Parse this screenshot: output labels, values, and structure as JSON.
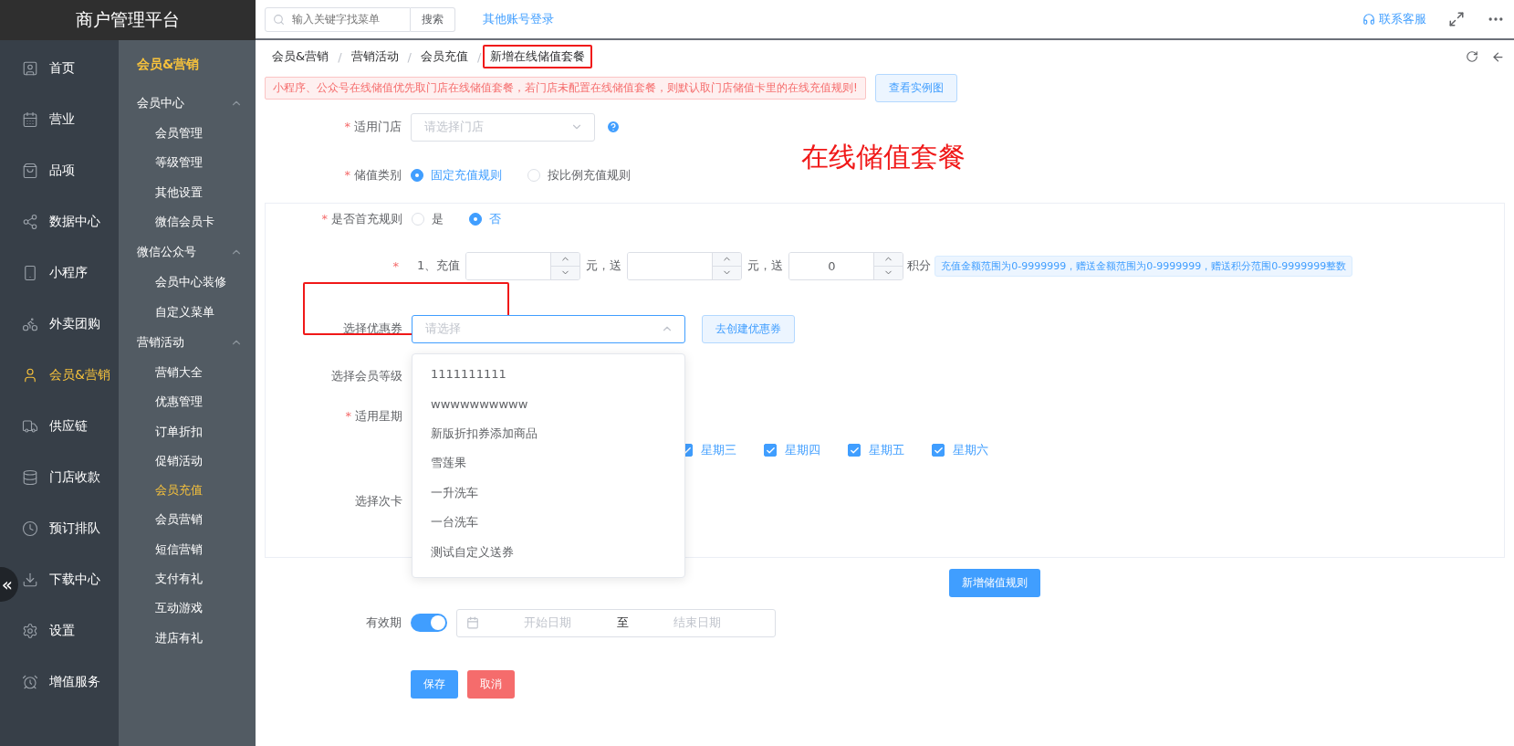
{
  "header": {
    "title": "商户管理平台",
    "search": {
      "placeholder": "输入关键字找菜单"
    },
    "search_button": "搜索",
    "other_login": "其他账号登录",
    "service": "联系客服"
  },
  "nav": [
    {
      "label": "首页",
      "selected": false
    },
    {
      "label": "营业",
      "selected": false
    },
    {
      "label": "品项",
      "selected": false
    },
    {
      "label": "数据中心",
      "selected": false
    },
    {
      "label": "小程序",
      "selected": false
    },
    {
      "label": "外卖团购",
      "selected": false
    },
    {
      "label": "会员&营销",
      "selected": true
    },
    {
      "label": "供应链",
      "selected": false
    },
    {
      "label": "门店收款",
      "selected": false
    },
    {
      "label": "预订排队",
      "selected": false
    },
    {
      "label": "下载中心",
      "selected": false
    },
    {
      "label": "设置",
      "selected": false
    },
    {
      "label": "增值服务",
      "selected": false
    }
  ],
  "collapse": "«",
  "subnav": {
    "title": "会员&营销",
    "groups": [
      {
        "label": "会员中心",
        "expanded": true,
        "children": [
          {
            "label": "会员管理",
            "selected": false
          },
          {
            "label": "等级管理",
            "selected": false
          },
          {
            "label": "其他设置",
            "selected": false
          },
          {
            "label": "微信会员卡",
            "selected": false
          }
        ]
      },
      {
        "label": "微信公众号",
        "expanded": true,
        "children": [
          {
            "label": "会员中心装修",
            "selected": false
          },
          {
            "label": "自定义菜单",
            "selected": false
          }
        ]
      },
      {
        "label": "营销活动",
        "expanded": true,
        "children": [
          {
            "label": "营销大全",
            "selected": false
          },
          {
            "label": "优惠管理",
            "selected": false
          },
          {
            "label": "订单折扣",
            "selected": false
          },
          {
            "label": "促销活动",
            "selected": false
          },
          {
            "label": "会员充值",
            "selected": true
          },
          {
            "label": "会员营销",
            "selected": false
          },
          {
            "label": "短信营销",
            "selected": false
          },
          {
            "label": "支付有礼",
            "selected": false
          },
          {
            "label": "互动游戏",
            "selected": false
          },
          {
            "label": "进店有礼",
            "selected": false
          }
        ]
      }
    ]
  },
  "breadcrumb_separator": "/",
  "breadcrumb": [
    {
      "label": "会员&营销",
      "highlighted": false
    },
    {
      "label": "营销活动",
      "highlighted": false
    },
    {
      "label": "会员充值",
      "highlighted": false
    },
    {
      "label": "新增在线储值套餐",
      "highlighted": true
    }
  ],
  "notice": "小程序、公众号在线储值优先取门店在线储值套餐，若门店未配置在线储值套餐，则默认取门店储值卡里的在线充值规则!",
  "example_button": "查看实例图",
  "annotation": "在线储值套餐",
  "store": {
    "label": "适用门店",
    "asterisk": "*",
    "placeholder": "请选择门店"
  },
  "category": {
    "label": "储值类别",
    "asterisk": "*",
    "options": [
      {
        "label": "固定充值规则",
        "selected": true
      },
      {
        "label": "按比例充值规则",
        "selected": false
      }
    ]
  },
  "first_charge": {
    "label": "是否首充规则",
    "asterisk": "*",
    "options": [
      {
        "label": "是",
        "selected": false
      },
      {
        "label": "否",
        "selected": true
      }
    ]
  },
  "recharge": {
    "asterisk": "*",
    "prefix": "1、充值",
    "unit1": "元，送",
    "unit2": "元，送",
    "points_value": "0",
    "points_unit": "积分",
    "tip": "充值金额范围为0-9999999，赠送金额范围为0-9999999，赠送积分范围0-9999999整数"
  },
  "coupon": {
    "label": "选择优惠券",
    "placeholder": "请选择",
    "highlighted": true,
    "create_button": "去创建优惠券",
    "expanded": true,
    "options": [
      "1111111111",
      "wwwwwwwwww",
      "新版折扣券添加商品",
      "雪莲果",
      "一升洗车",
      "一台洗车",
      "测试自定义送券"
    ]
  },
  "member_level": {
    "label": "选择会员等级"
  },
  "weekdays": {
    "label": "适用星期",
    "asterisk": "*",
    "days": [
      {
        "label": "星期三",
        "checked": true
      },
      {
        "label": "星期四",
        "checked": true
      },
      {
        "label": "星期五",
        "checked": true
      },
      {
        "label": "星期六",
        "checked": true
      }
    ]
  },
  "times_card": {
    "label": "选择次卡"
  },
  "add_rule_button": "新增储值规则",
  "validity": {
    "label": "有效期",
    "on": true,
    "start_placeholder": "开始日期",
    "separator": "至",
    "end_placeholder": "结束日期"
  },
  "save_button": "保存",
  "cancel_button": "取消"
}
